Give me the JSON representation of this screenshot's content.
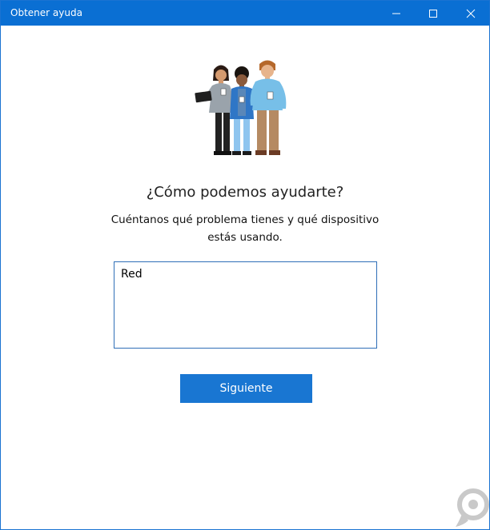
{
  "window": {
    "title": "Obtener ayuda",
    "controls": [
      "minimize-icon",
      "maximize-icon",
      "close-icon"
    ],
    "accent_color": "#0a6fd3"
  },
  "main": {
    "heading": "¿Cómo podemos ayudarte?",
    "description": "Cuéntanos qué problema tienes y qué dispositivo estás usando.",
    "input_value": "Red",
    "next_label": "Siguiente",
    "button_color": "#1976d2"
  }
}
